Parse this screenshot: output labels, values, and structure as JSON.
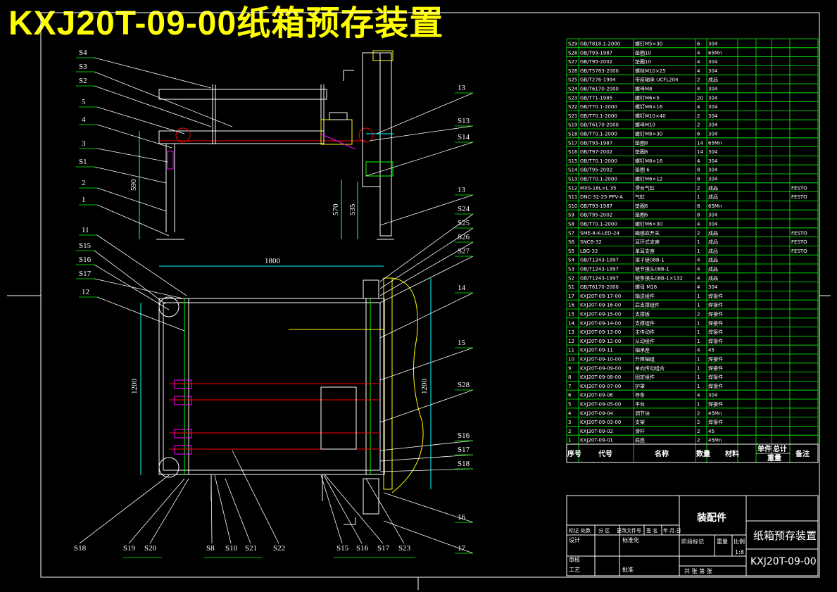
{
  "title": "KXJ20T-09-00纸箱预存装置",
  "colors": {
    "background": "#000000",
    "frame": "#ffffff",
    "grid": "#00ff00",
    "part": "#ffffff",
    "dim": "#00ffff",
    "center": "#ff0000",
    "accent": "#ffff00",
    "purple": "#ff00ff",
    "title": "#ffff00"
  },
  "balloons_left": [
    "S4",
    "S3",
    "S2",
    "5",
    "4",
    "3",
    "S1",
    "2",
    "1",
    "11",
    "S15",
    "S16",
    "S17",
    "12"
  ],
  "balloons_right": [
    "13",
    "S13",
    "S14",
    "13",
    "S24",
    "S25",
    "S26",
    "S27",
    "14",
    "15",
    "S28",
    "S16",
    "S17",
    "S18",
    "16",
    "17"
  ],
  "balloons_bottom": [
    "S18",
    "S19",
    "S20",
    "S8",
    "S10",
    "S21",
    "S22",
    "S15",
    "S16",
    "S17",
    "S23"
  ],
  "dimensions": {
    "width_top": "1800",
    "height_left": "1200",
    "height_right": "1200",
    "small_a": "590",
    "small_b": "570",
    "small_c": "535"
  },
  "bom": {
    "rows": [
      [
        "S29",
        "GB/T818.1-2000",
        "螺钉M5×30",
        "6",
        "304",
        ""
      ],
      [
        "S28",
        "GB/T93-1987",
        "垫圈10",
        "4",
        "65Mn",
        ""
      ],
      [
        "S27",
        "GB/T95-2002",
        "垫圈10",
        "4",
        "304",
        ""
      ],
      [
        "S26",
        "GB/T5783-2000",
        "螺栓M10×25",
        "4",
        "304",
        ""
      ],
      [
        "S25",
        "GB/T276-1994",
        "带座轴承 UCFL204",
        "2",
        "成品",
        ""
      ],
      [
        "S24",
        "GB/T6170-2000",
        "螺母M8",
        "4",
        "304",
        ""
      ],
      [
        "S23",
        "GB/T71-1985",
        "螺钉M6×5",
        "20",
        "304",
        ""
      ],
      [
        "S22",
        "GB/T70.1-2000",
        "螺钉M6×16",
        "4",
        "304",
        ""
      ],
      [
        "S21",
        "GB/T70.1-2000",
        "螺钉M10×40",
        "2",
        "304",
        ""
      ],
      [
        "S19",
        "GB/T6170-2000",
        "螺母M10",
        "2",
        "304",
        ""
      ],
      [
        "S18",
        "GB/T70.1-2000",
        "螺钉M8×30",
        "6",
        "304",
        ""
      ],
      [
        "S17",
        "GB/T93-1987",
        "垫圈8",
        "14",
        "65Mn",
        ""
      ],
      [
        "S16",
        "GB/T97-2002",
        "垫圈8",
        "14",
        "304",
        ""
      ],
      [
        "S15",
        "GB/T70.1-2000",
        "螺钉M8×16",
        "4",
        "304",
        ""
      ],
      [
        "S14",
        "GB/T95-2002",
        "垫圈 6",
        "8",
        "304",
        ""
      ],
      [
        "S13",
        "GB/T70.1-2000",
        "螺钉M6×12",
        "8",
        "304",
        ""
      ],
      [
        "S12",
        "MXS-16L×L 35",
        "滑台气缸",
        "2",
        "成品",
        "FESTO"
      ],
      [
        "S11",
        "DNC-32-25-PPV-A",
        "气缸",
        "1",
        "成品",
        "FESTO"
      ],
      [
        "S10",
        "GB/T93-1987",
        "垫圈6",
        "8",
        "65Mn",
        ""
      ],
      [
        "S9",
        "GB/T95-2002",
        "垫圈6",
        "8",
        "304",
        ""
      ],
      [
        "S8",
        "GB/T70.1-2000",
        "螺钉M6×30",
        "4",
        "304",
        ""
      ],
      [
        "S7",
        "SME-8-K-LED-24",
        "磁感应开关",
        "2",
        "成品",
        "FESTO"
      ],
      [
        "S6",
        "SNCB-32",
        "耳环式支座",
        "1",
        "成品",
        "FESTO"
      ],
      [
        "S5",
        "LBG-32",
        "单耳支座",
        "1",
        "成品",
        "FESTO"
      ],
      [
        "S4",
        "GB/T1243-1997",
        "滚子链08B-1",
        "4",
        "成品",
        ""
      ],
      [
        "S3",
        "GB/T1243-1997",
        "链节接头08B-1",
        "4",
        "成品",
        ""
      ],
      [
        "S2",
        "GB/T1243-1997",
        "链条接头08B-1×132",
        "4",
        "成品",
        ""
      ],
      [
        "S1",
        "GB/T6170-2000",
        "螺母 M16",
        "4",
        "304",
        ""
      ],
      [
        "17",
        "KXJ20T-09-17-00",
        "输送组件",
        "1",
        "焊接件",
        ""
      ],
      [
        "16",
        "KXJ20T-09-16-00",
        "后支撑组件",
        "1",
        "焊接件",
        ""
      ],
      [
        "15",
        "KXJ20T-09-15-00",
        "支撑板",
        "2",
        "焊接件",
        ""
      ],
      [
        "14",
        "KXJ20T-09-14-00",
        "支撑组件",
        "1",
        "焊接件",
        ""
      ],
      [
        "13",
        "KXJ20T-09-13-00",
        "主传动件",
        "1",
        "焊接件",
        ""
      ],
      [
        "12",
        "KXJ20T-09-12-00",
        "从动组件",
        "1",
        "焊接件",
        ""
      ],
      [
        "11",
        "KXJ20T-09-11",
        "轴承座",
        "4",
        "45",
        ""
      ],
      [
        "10",
        "KXJ20T-09-10-00",
        "升降轴组",
        "1",
        "焊接件",
        ""
      ],
      [
        "9",
        "KXJ20T-09-09-00",
        "单向传动组合",
        "1",
        "焊接件",
        ""
      ],
      [
        "8",
        "KXJ20T-09-08-00",
        "固定组件",
        "1",
        "焊接件",
        ""
      ],
      [
        "7",
        "KXJ20T-09-07-00",
        "护罩",
        "1",
        "焊接件",
        ""
      ],
      [
        "6",
        "KXJ20T-09-06",
        "导条",
        "4",
        "304",
        ""
      ],
      [
        "5",
        "KXJ20T-09-05-00",
        "平台",
        "1",
        "焊接件",
        ""
      ],
      [
        "4",
        "KXJ20T-09-04",
        "调节块",
        "2",
        "45Mn",
        ""
      ],
      [
        "3",
        "KXJ20T-09-03-00",
        "支架",
        "2",
        "焊接件",
        ""
      ],
      [
        "2",
        "KXJ20T-09-02",
        "滑杆",
        "2",
        "45",
        ""
      ],
      [
        "1",
        "KXJ20T-09-01",
        "底座",
        "2",
        "45Mn",
        ""
      ]
    ],
    "header": [
      "序号",
      "代号",
      "名称",
      "数量",
      "材料",
      "单件",
      "总计",
      "备注"
    ],
    "header_sub": "重量"
  },
  "title_block": {
    "name": "纸箱预存装置",
    "drawing_no": "KXJ20T-09-00",
    "type": "装配件",
    "scale": "1:8",
    "row_labels": [
      "标记",
      "处数",
      "分 区",
      "更改文件号",
      "签 名",
      "年.月.日"
    ],
    "designer": "设计",
    "standard": "标准化",
    "stage": "阶段标记",
    "weight": "重量",
    "scale_label": "比例",
    "checker": "审核",
    "process": "工艺",
    "approve": "批准",
    "sheets": "共   张   第   张"
  }
}
